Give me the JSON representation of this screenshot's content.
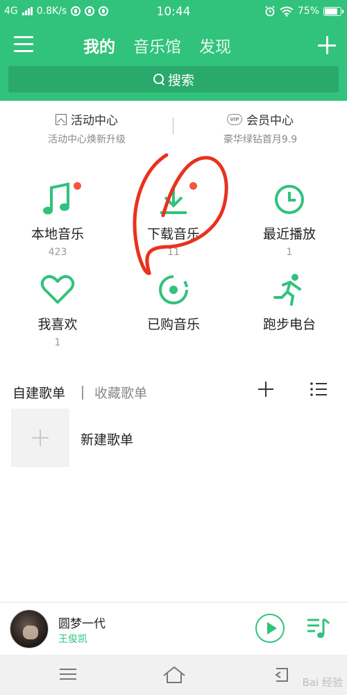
{
  "status_bar": {
    "network": "4G",
    "speed": "0.8K/s",
    "time": "10:44",
    "battery": "75%"
  },
  "nav": {
    "tabs": [
      {
        "label": "我的"
      },
      {
        "label": "音乐馆"
      },
      {
        "label": "发现"
      }
    ]
  },
  "search": {
    "label": "搜索"
  },
  "promo": {
    "activity": {
      "title": "活动中心",
      "subtitle": "活动中心焕新升级"
    },
    "vip": {
      "title": "会员中心",
      "subtitle": "豪华绿钻首月9.9",
      "badge": "VIP"
    }
  },
  "grid": {
    "items": [
      {
        "label": "本地音乐",
        "count": "423",
        "icon": "music-note-icon"
      },
      {
        "label": "下载音乐",
        "count": "11",
        "icon": "download-icon"
      },
      {
        "label": "最近播放",
        "count": "1",
        "icon": "clock-icon"
      },
      {
        "label": "我喜欢",
        "count": "1",
        "icon": "heart-icon"
      },
      {
        "label": "已购音乐",
        "count": "",
        "icon": "disc-icon"
      },
      {
        "label": "跑步电台",
        "count": "",
        "icon": "runner-icon"
      }
    ]
  },
  "playlists": {
    "own_tab": "自建歌单",
    "fav_tab": "收藏歌单",
    "new_label": "新建歌单"
  },
  "player": {
    "title": "圆梦一代",
    "artist": "王俊凯"
  },
  "watermark": "Bai 经验",
  "colors": {
    "brand_green": "#31c27c",
    "badge_red": "#f5563d",
    "annotation_red": "#e8321e"
  }
}
